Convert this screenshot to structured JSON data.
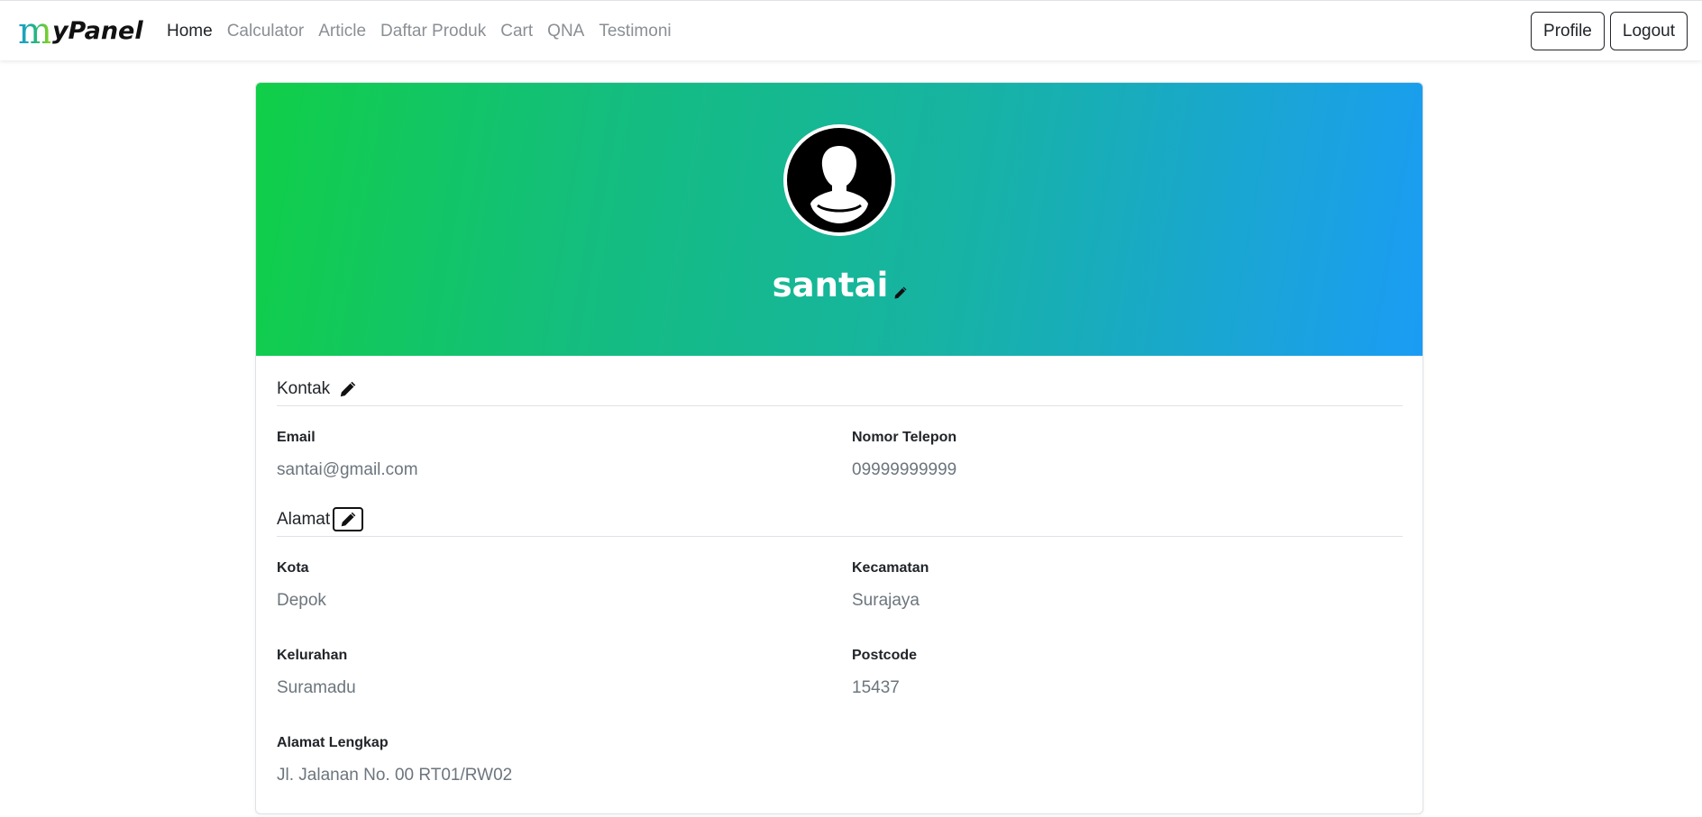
{
  "brand": {
    "m": "m",
    "rest": "yPanel"
  },
  "nav": {
    "links": [
      {
        "label": "Home"
      },
      {
        "label": "Calculator"
      },
      {
        "label": "Article"
      },
      {
        "label": "Daftar Produk"
      },
      {
        "label": "Cart"
      },
      {
        "label": "QNA"
      },
      {
        "label": "Testimoni"
      }
    ],
    "profile_label": "Profile",
    "logout_label": "Logout"
  },
  "profile": {
    "username": "santai",
    "kontak": {
      "title": "Kontak",
      "email_label": "Email",
      "email": "santai@gmail.com",
      "phone_label": "Nomor Telepon",
      "phone": "09999999999"
    },
    "alamat": {
      "title": "Alamat",
      "kota_label": "Kota",
      "kota": "Depok",
      "kecamatan_label": "Kecamatan",
      "kecamatan": "Surajaya",
      "kelurahan_label": "Kelurahan",
      "kelurahan": "Suramadu",
      "postcode_label": "Postcode",
      "postcode": "15437",
      "lengkap_label": "Alamat Lengkap",
      "lengkap": "Jl. Jalanan No. 00 RT01/RW02"
    }
  },
  "colors": {
    "gradient_start": "#10cf47",
    "gradient_end": "#1b9cf5",
    "muted_text": "#6c757d"
  },
  "icons": {
    "avatar": "user-silhouette-icon",
    "edit": "pencil-icon"
  }
}
